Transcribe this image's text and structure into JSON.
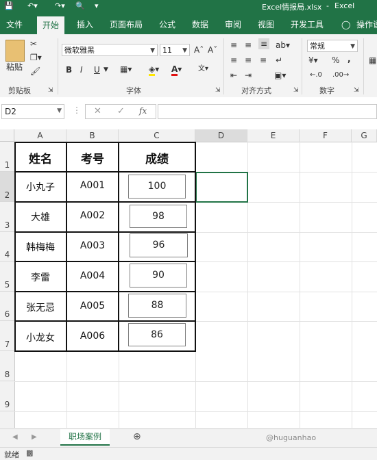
{
  "title_bar": {
    "file_name": "Excel情报局.xlsx",
    "separator": "-",
    "app_name": "Excel"
  },
  "ribbon_tabs": [
    "文件",
    "开始",
    "插入",
    "页面布局",
    "公式",
    "数据",
    "审阅",
    "视图",
    "开发工具",
    "操作说"
  ],
  "active_tab": "开始",
  "ribbon": {
    "clipboard": {
      "paste_label": "粘贴",
      "group_label": "剪贴板"
    },
    "font": {
      "font_name": "微软雅黑",
      "font_size": "11",
      "group_label": "字体",
      "bold": "B",
      "italic": "I",
      "underline": "U"
    },
    "alignment": {
      "group_label": "对齐方式"
    },
    "number": {
      "format": "常规",
      "group_label": "数字",
      "percent": "%",
      "comma": ","
    }
  },
  "formula_bar": {
    "name_box": "D2",
    "fx": "fx",
    "formula": ""
  },
  "columns": [
    "A",
    "B",
    "C",
    "D",
    "E",
    "F",
    "G"
  ],
  "rows": [
    "1",
    "2",
    "3",
    "4",
    "5",
    "6",
    "7",
    "8",
    "9"
  ],
  "table": {
    "headers": [
      "姓名",
      "考号",
      "成绩"
    ],
    "records": [
      {
        "name": "小丸子",
        "id": "A001",
        "score": "100"
      },
      {
        "name": "大雄",
        "id": "A002",
        "score": "98"
      },
      {
        "name": "韩梅梅",
        "id": "A003",
        "score": "96"
      },
      {
        "name": "李雷",
        "id": "A004",
        "score": "90"
      },
      {
        "name": "张无忌",
        "id": "A005",
        "score": "88"
      },
      {
        "name": "小龙女",
        "id": "A006",
        "score": "86"
      }
    ]
  },
  "sheet_tabs": [
    "职场案例"
  ],
  "status": {
    "ready": "就绪"
  },
  "watermark": "@huguanhao"
}
